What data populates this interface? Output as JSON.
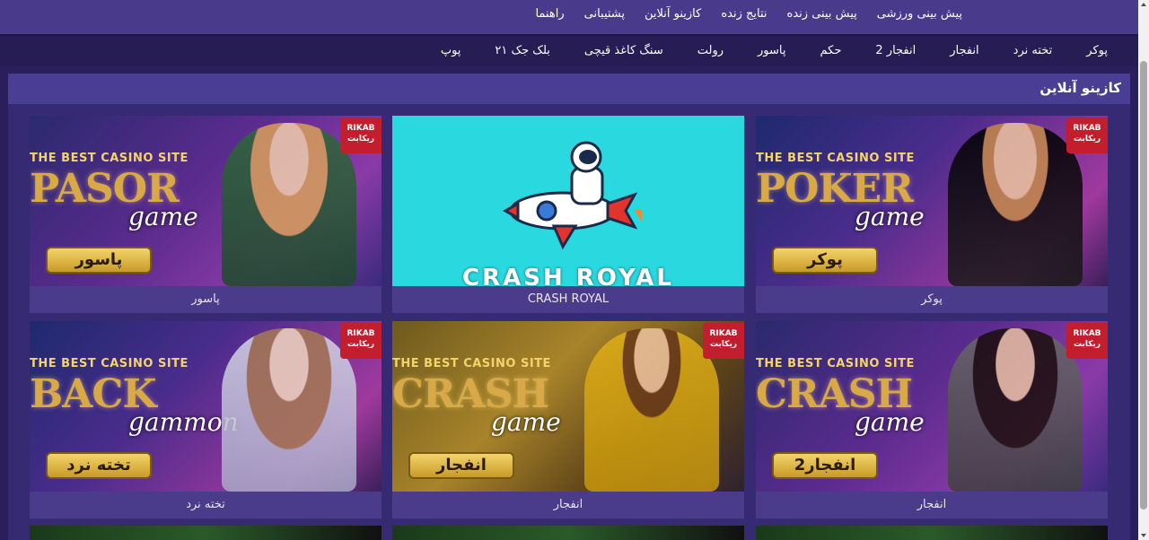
{
  "top_nav": {
    "items": [
      "پیش بینی ورزشی",
      "پیش بینی زنده",
      "نتایج زنده",
      "کازینو آنلاین",
      "پشتیبانی",
      "راهنما"
    ]
  },
  "sub_nav": {
    "items": [
      "پوکر",
      "تخته نرد",
      "انفجار",
      "انفجار 2",
      "حکم",
      "پاسور",
      "رولت",
      "سنگ کاغذ قیچی",
      "بلک جک ۲۱",
      "پوپ"
    ]
  },
  "section": {
    "title": "کازینو آنلاین"
  },
  "cards": [
    {
      "caption": "پاسور",
      "headline": "PASOR",
      "script": "game",
      "badge": "پاسور",
      "best": "THE BEST CASINO SITE",
      "logo": "RIKAB ریکابت"
    },
    {
      "caption": "CRASH ROYAL",
      "headline": "CRASH ROYAL"
    },
    {
      "caption": "پوکر",
      "headline": "POKER",
      "script": "game",
      "badge": "پوکر",
      "best": "THE BEST CASINO SITE",
      "logo": "RIKAB ریکابت"
    },
    {
      "caption": "تخته نرد",
      "headline": "BACK",
      "script": "gammon",
      "badge": "تخته نرد",
      "best": "THE BEST CASINO SITE",
      "logo": "RIKAB ریکابت"
    },
    {
      "caption": "انفجار",
      "headline": "CRASH",
      "script": "game",
      "badge": "انفجار",
      "best": "THE BEST CASINO SITE",
      "logo": "RIKAB ریکابت"
    },
    {
      "caption": "انفجار",
      "headline": "CRASH",
      "script": "game",
      "badge": "انفجار2",
      "best": "THE BEST CASINO SITE",
      "logo": "RIKAB ریکابت"
    }
  ]
}
